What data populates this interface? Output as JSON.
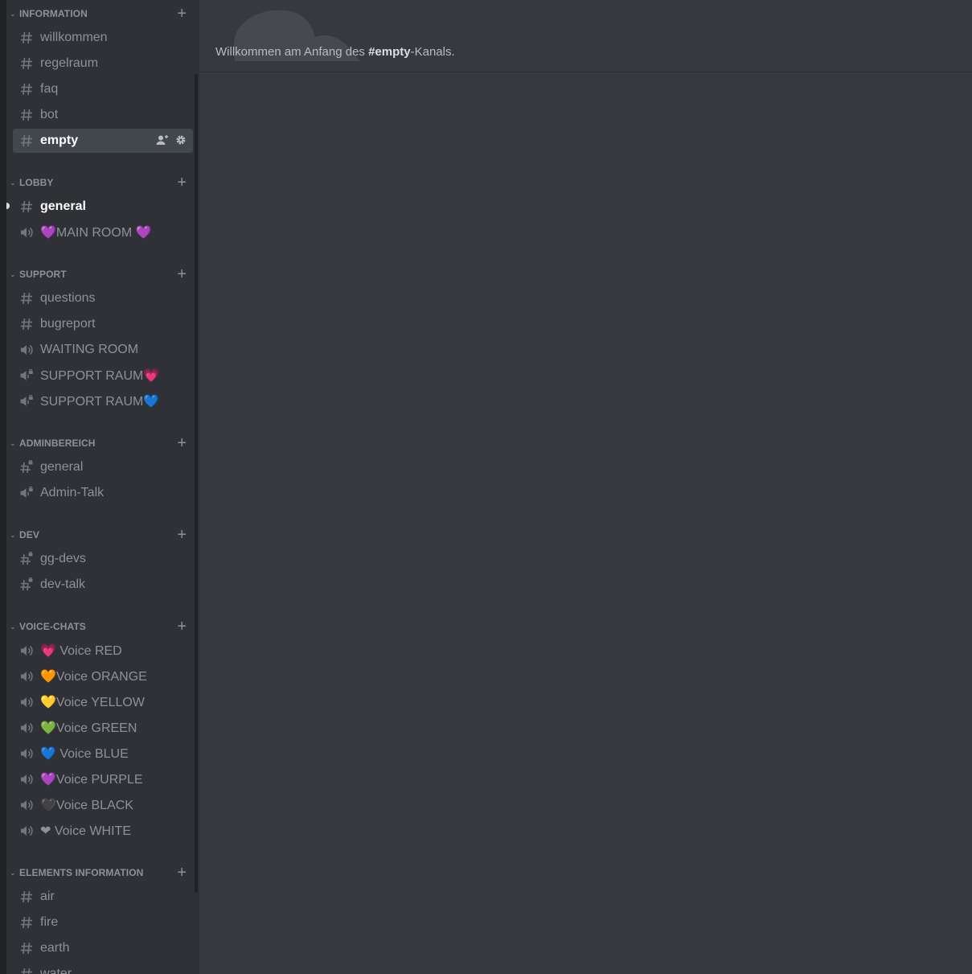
{
  "categories": [
    {
      "label": "INFORMATION",
      "channels": [
        {
          "icon": "hash-icon",
          "name": "willkommen"
        },
        {
          "icon": "hash-icon",
          "name": "regelraum"
        },
        {
          "icon": "hash-icon",
          "name": "faq"
        },
        {
          "icon": "hash-icon",
          "name": "bot"
        },
        {
          "icon": "hash-icon",
          "name": "empty",
          "state": "active"
        }
      ]
    },
    {
      "label": "LOBBY",
      "channels": [
        {
          "icon": "hash-icon",
          "name": "general",
          "state": "unread"
        },
        {
          "icon": "speaker-icon",
          "name": "💜MAIN ROOM 💜"
        }
      ]
    },
    {
      "label": "SUPPORT",
      "channels": [
        {
          "icon": "hash-icon",
          "name": "questions"
        },
        {
          "icon": "hash-icon",
          "name": "bugreport"
        },
        {
          "icon": "speaker-icon",
          "name": "WAITING ROOM"
        },
        {
          "icon": "speaker-locked-icon",
          "name": "SUPPORT RAUM💗"
        },
        {
          "icon": "speaker-locked-icon",
          "name": "SUPPORT RAUM💙"
        }
      ]
    },
    {
      "label": "ADMINBEREICH",
      "channels": [
        {
          "icon": "hash-locked-icon",
          "name": "general"
        },
        {
          "icon": "speaker-locked-icon",
          "name": "Admin-Talk"
        }
      ]
    },
    {
      "label": "DEV",
      "channels": [
        {
          "icon": "hash-locked-icon",
          "name": "gg-devs"
        },
        {
          "icon": "hash-locked-icon",
          "name": "dev-talk"
        }
      ]
    },
    {
      "label": "VOICE-CHATS",
      "channels": [
        {
          "icon": "speaker-icon",
          "name": "💗 Voice RED"
        },
        {
          "icon": "speaker-icon",
          "name": "🧡Voice ORANGE"
        },
        {
          "icon": "speaker-icon",
          "name": "💛Voice YELLOW"
        },
        {
          "icon": "speaker-icon",
          "name": "💚Voice GREEN"
        },
        {
          "icon": "speaker-icon",
          "name": "💙 Voice BLUE"
        },
        {
          "icon": "speaker-icon",
          "name": "💜Voice PURPLE"
        },
        {
          "icon": "speaker-icon",
          "name": "🖤Voice BLACK"
        },
        {
          "icon": "speaker-icon",
          "name": "❤ Voice WHITE"
        }
      ]
    },
    {
      "label": "ELEMENTS INFORMATION",
      "channels": [
        {
          "icon": "hash-icon",
          "name": "air"
        },
        {
          "icon": "hash-icon",
          "name": "fire"
        },
        {
          "icon": "hash-icon",
          "name": "earth"
        },
        {
          "icon": "hash-icon",
          "name": "water"
        }
      ]
    }
  ],
  "welcome": {
    "prefix": "Willkommen am Anfang des ",
    "channel": "#empty",
    "suffix": "-Kanals."
  },
  "colors": {
    "sidebar": "#2f3136",
    "chat": "#36393f",
    "muted_text": "#8e9297",
    "active_bg": "#42464d"
  }
}
